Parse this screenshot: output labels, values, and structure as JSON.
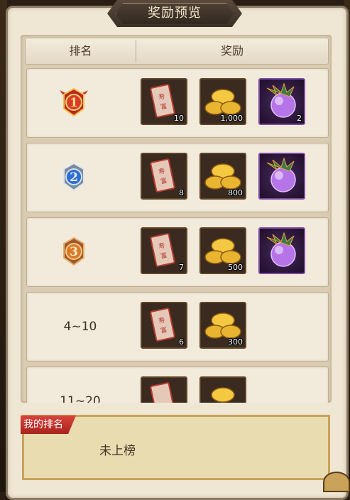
{
  "title": "奖励预览",
  "header": {
    "rank_label": "排名",
    "reward_label": "奖励"
  },
  "rows": [
    {
      "rank": "1",
      "rank_style": "gold-medal",
      "rewards": [
        {
          "icon": "red-envelope-icon",
          "qty": "10"
        },
        {
          "icon": "gold-ingot-icon",
          "qty": "1,000"
        },
        {
          "icon": "purple-dragon-orb-icon",
          "qty": "2"
        }
      ]
    },
    {
      "rank": "2",
      "rank_style": "silver-medal",
      "rewards": [
        {
          "icon": "red-envelope-icon",
          "qty": "8"
        },
        {
          "icon": "gold-ingot-icon",
          "qty": "800"
        },
        {
          "icon": "purple-dragon-orb-icon",
          "qty": ""
        }
      ]
    },
    {
      "rank": "3",
      "rank_style": "bronze-medal",
      "rewards": [
        {
          "icon": "red-envelope-icon",
          "qty": "7"
        },
        {
          "icon": "gold-ingot-icon",
          "qty": "500"
        },
        {
          "icon": "purple-dragon-orb-icon",
          "qty": ""
        }
      ]
    },
    {
      "rank": "4~10",
      "rank_style": "text",
      "rewards": [
        {
          "icon": "red-envelope-icon",
          "qty": "6"
        },
        {
          "icon": "gold-ingot-icon",
          "qty": "300"
        }
      ]
    },
    {
      "rank": "11~20",
      "rank_style": "text",
      "rewards": [
        {
          "icon": "red-envelope-icon",
          "qty": ""
        },
        {
          "icon": "gold-ingot-icon",
          "qty": ""
        }
      ]
    }
  ],
  "my_rank": {
    "label": "我的排名",
    "value": "未上榜"
  },
  "colors": {
    "panel": "#efe6d3",
    "tag_red": "#c2322b",
    "gold": "#c8a25a",
    "epic_purple": "#7b4aa0"
  }
}
